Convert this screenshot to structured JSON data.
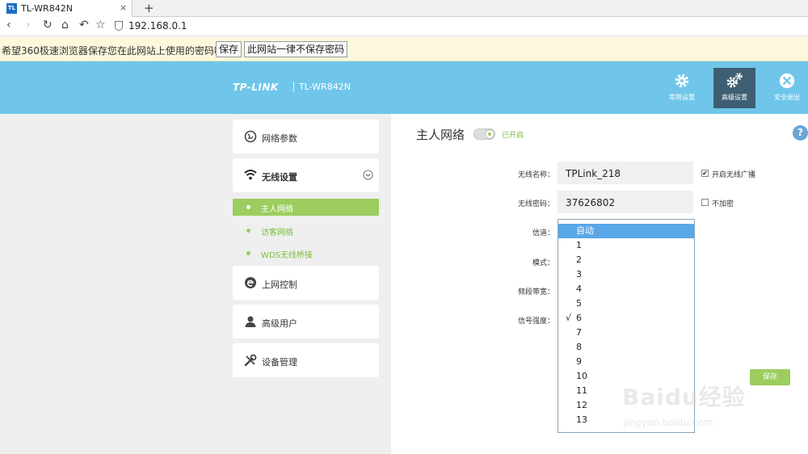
{
  "browser": {
    "tab_title": "TL-WR842N",
    "tab_favicon": "TL",
    "tab_close": "×",
    "new_tab": "+",
    "url": "192.168.0.1",
    "nav": {
      "back": "‹",
      "forward": "›",
      "reload": "↻",
      "home": "⌂",
      "undo": "↶",
      "star": "☆"
    }
  },
  "password_bar": {
    "message": "希望360极速浏览器保存您在此网站上使用的密码吗？",
    "save_label": "保存",
    "never_label": "此网站一律不保存密码"
  },
  "header": {
    "brand": "TP-LINK",
    "model": "TL-WR842N",
    "buttons": [
      {
        "label": "常用设置",
        "icon": "gear-icon"
      },
      {
        "label": "高级设置",
        "icon": "gears-icon",
        "active": true
      },
      {
        "label": "安全退出",
        "icon": "close-circle-icon"
      }
    ],
    "color": "#6fc6ea"
  },
  "sidebar": {
    "items": [
      {
        "label": "网络参数",
        "icon": "globe-icon"
      },
      {
        "label": "无线设置",
        "icon": "wifi-icon",
        "expanded": true
      },
      {
        "label": "上网控制",
        "icon": "e-icon"
      },
      {
        "label": "高级用户",
        "icon": "user-icon"
      },
      {
        "label": "设备管理",
        "icon": "tools-icon"
      }
    ],
    "subitems": [
      {
        "label": "主人网络",
        "active": true
      },
      {
        "label": "访客网络"
      },
      {
        "label": "WDS无线桥接"
      }
    ],
    "accent": "#9ccd5e"
  },
  "main": {
    "title": "主人网络",
    "toggle_status": "已开启",
    "help": "?",
    "fields": {
      "ssid_label": "无线名称：",
      "ssid_value": "TPLink_218",
      "broadcast_label": "开启无线广播",
      "broadcast_checked": "✔",
      "password_label": "无线密码：",
      "password_value": "37626802",
      "no_encrypt_label": "不加密",
      "channel_label": "信道：",
      "mode_label": "模式：",
      "bandwidth_label": "频段带宽：",
      "signal_label": "信号强度："
    },
    "channel_options": [
      "自动",
      "1",
      "2",
      "3",
      "4",
      "5",
      "6",
      "7",
      "8",
      "9",
      "10",
      "11",
      "12",
      "13"
    ],
    "channel_highlighted": "自动",
    "channel_checked_mark": "√",
    "save_label": "保存"
  },
  "watermark": {
    "main": "Baidu经验",
    "sub": "jingyan.baidu.com"
  }
}
